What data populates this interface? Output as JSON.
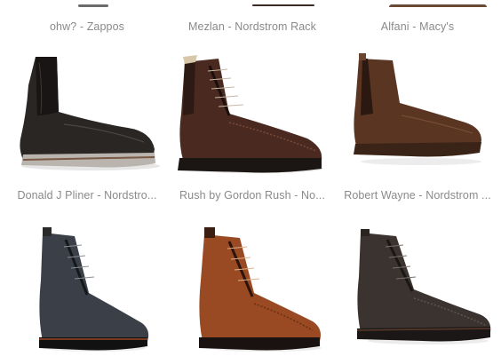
{
  "products": [
    {
      "caption": "ohw? - Zappos"
    },
    {
      "caption": "Mezlan - Nordstrom Rack"
    },
    {
      "caption": "Alfani - Macy's"
    },
    {
      "caption": "Donald J Pliner - Nordstro..."
    },
    {
      "caption": "Rush by Gordon Rush - No..."
    },
    {
      "caption": "Robert Wayne - Nordstrom ..."
    },
    {
      "caption": ""
    },
    {
      "caption": ""
    },
    {
      "caption": ""
    }
  ]
}
